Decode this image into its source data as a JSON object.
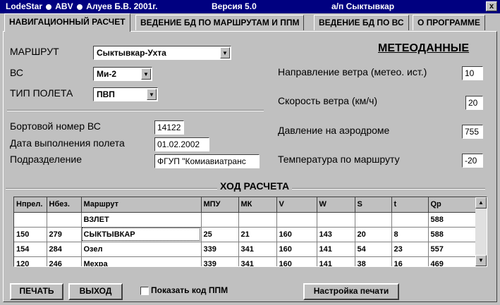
{
  "titlebar": {
    "app": "LodeStar",
    "author_prefix": "ABV",
    "author": "Алуев Б.В.  2001г.",
    "version": "Версия 5.0",
    "airport": "а/п Сыктывкар",
    "close_glyph": "x"
  },
  "tabs": [
    {
      "label": "НАВИГАЦИОННЫЙ РАСЧЕТ",
      "active": true
    },
    {
      "label": "ВЕДЕНИЕ БД ПО МАРШРУТАМ  И ППМ",
      "active": false
    },
    {
      "label": "ВЕДЕНИЕ БД ПО ВС",
      "active": false
    },
    {
      "label": "О ПРОГРАММЕ",
      "active": false
    }
  ],
  "form": {
    "route_label": "МАРШРУТ",
    "route_value": "Сыктывкар-Ухта",
    "aircraft_label": "ВС",
    "aircraft_value": "Ми-2",
    "flight_type_label": "ТИП ПОЛЕТА",
    "flight_type_value": "ПВП",
    "tail_label": "Бортовой номер ВС",
    "tail_value": "14122",
    "date_label": "Дата выполнения полета",
    "date_value": "01.02.2002",
    "unit_label": "Подразделение",
    "unit_value": "ФГУП \"Комиавиатранс"
  },
  "meteo": {
    "title": "МЕТЕОДАННЫЕ",
    "wind_dir_label": "Направление ветра (метео. ист.)",
    "wind_dir_value": "10",
    "wind_speed_label": "Скорость ветра (км/ч)",
    "wind_speed_value": "20",
    "pressure_label": "Давление на аэродроме",
    "pressure_value": "755",
    "temp_label": "Температура по маршруту",
    "temp_value": "-20"
  },
  "progress": {
    "title": "ХОД РАСЧЕТА",
    "columns": [
      "Нпрел.",
      "Нбез.",
      "Маршрут",
      "МПУ",
      "МК",
      "V",
      "W",
      "S",
      "t",
      "Qp"
    ],
    "rows": [
      [
        "",
        "",
        "ВЗЛЕТ",
        "",
        "",
        "",
        "",
        "",
        "",
        "588"
      ],
      [
        "150",
        "279",
        "СЫКТЫВКАР",
        "25",
        "21",
        "160",
        "143",
        "20",
        "8",
        "588"
      ],
      [
        "154",
        "284",
        "Озел",
        "339",
        "341",
        "160",
        "141",
        "54",
        "23",
        "557"
      ],
      [
        "120",
        "246",
        "Мехра",
        "339",
        "341",
        "160",
        "141",
        "38",
        "16",
        "469"
      ]
    ]
  },
  "buttons": {
    "print": "ПЕЧАТЬ",
    "exit": "ВЫХОД",
    "show_ppm_code": "Показать код ППМ",
    "print_settings": "Настройка печати"
  },
  "colors": {
    "titlebar_bg": "#000080",
    "window_bg": "#c0c0c0"
  }
}
